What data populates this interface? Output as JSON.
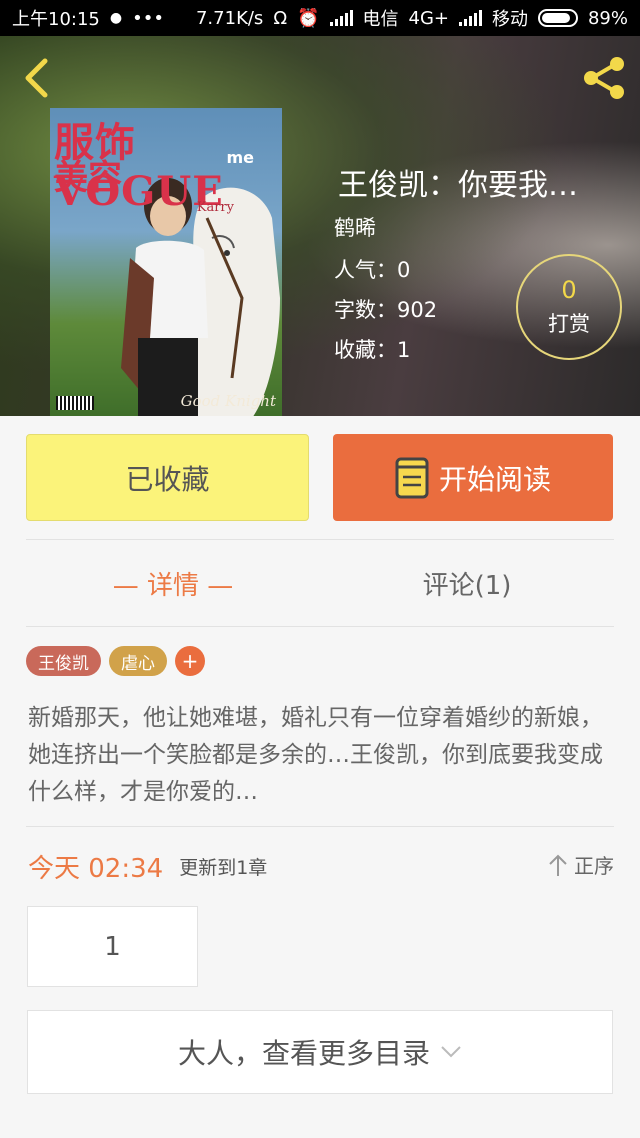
{
  "status_bar": {
    "time": "上午10:15",
    "speed": "7.71K/s",
    "carrier1": "电信",
    "network": "4G+",
    "carrier2": "移动",
    "battery": "89%",
    "battery_level": 0.89
  },
  "book": {
    "title": "王俊凯：你要我…",
    "author": "鹤晞",
    "popularity_label": "人气：",
    "popularity": "0",
    "wordcount_label": "字数：",
    "wordcount": "902",
    "favorites_label": "收藏：",
    "favorites": "1",
    "cover": {
      "masthead": "服饰VOGUE",
      "masthead2": "美容",
      "me": "me",
      "karry": "Karry",
      "knight": "Good Knight"
    }
  },
  "reward": {
    "count": "0",
    "label": "打赏"
  },
  "actions": {
    "collected_label": "已收藏",
    "read_label": "开始阅读"
  },
  "tabs": {
    "detail": "— 详情 —",
    "comments": "评论(1)"
  },
  "tags": [
    {
      "label": "王俊凯",
      "color": "#c9695a"
    },
    {
      "label": "虐心",
      "color": "#d1a24a"
    }
  ],
  "summary": "新婚那天，他让她难堪，婚礼只有一位穿着婚纱的新娘，她连挤出一个笑脸都是多余的…王俊凯，你到底要我变成什么样，才是你爱的…",
  "update": {
    "time": "今天 02:34",
    "text": "更新到1章",
    "sort_label": "正序"
  },
  "chapters": [
    "1"
  ],
  "more_catalog": "大人，查看更多目录",
  "colors": {
    "accent": "#ea6d3e",
    "collected_bg": "#fbf37a",
    "reward_gold": "#f2d84a"
  }
}
